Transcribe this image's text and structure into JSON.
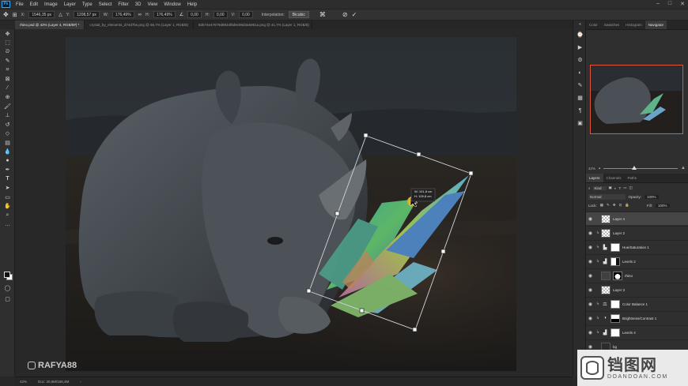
{
  "app": {
    "logo": "Ps"
  },
  "menu": [
    "File",
    "Edit",
    "Image",
    "Layer",
    "Type",
    "Select",
    "Filter",
    "3D",
    "View",
    "Window",
    "Help"
  ],
  "options": {
    "x_label": "X:",
    "x_value": "1546,35 px",
    "y_label": "Y:",
    "y_value": "1208,57 px",
    "w_label": "W:",
    "w_value": "176,49%",
    "h_label": "H:",
    "h_value": "176,49%",
    "angle_value": "0,00",
    "h2_label": "H:",
    "h2_value": "0,00",
    "v_label": "V:",
    "v_value": "0,00",
    "interp_label": "Interpolation:",
    "interp_value": "Bicubic"
  },
  "tabs": [
    {
      "label": "rhino.psd @ 42% (Layer 4, RGB/8#) *",
      "active": true
    },
    {
      "label": "crystal_by_elements_d74d7bs.png @ 66,7% (Layer 1, RGB/8)",
      "active": false
    },
    {
      "label": "8d574e47679d8834f8d9c98d3a5951a.png @ 41,7% (Layer 1, RGB/8)",
      "active": false
    }
  ],
  "transform_readout": {
    "w": "W: 101,8 cm",
    "h": "H: 109,8 cm"
  },
  "status": {
    "zoom": "42%",
    "doc": "Doc: 30,6M/166,4M"
  },
  "watermark": {
    "text": "RAFYA88"
  },
  "panel_tabs_top": [
    "Color",
    "Swatches",
    "Histogram",
    "Navigator"
  ],
  "navigator": {
    "zoom": "42%"
  },
  "layers_tabs": [
    "Layers",
    "Channels",
    "Paths"
  ],
  "layers": {
    "kind_label": "Kind",
    "blend_mode": "Normal",
    "opacity_label": "Opacity:",
    "opacity": "100%",
    "lock_label": "Lock:",
    "fill_label": "Fill:",
    "fill": "100%",
    "items": [
      {
        "name": "Layer 4",
        "selected": true
      },
      {
        "name": "Layer 2",
        "selected": false
      },
      {
        "name": "Hue/Saturation 1",
        "selected": false
      },
      {
        "name": "Levels 2",
        "selected": false
      },
      {
        "name": "rhino",
        "selected": false
      },
      {
        "name": "Layer 3",
        "selected": false
      },
      {
        "name": "Color Balance 1",
        "selected": false
      },
      {
        "name": "Brightness/Contrast 1",
        "selected": false
      },
      {
        "name": "Levels 4",
        "selected": false
      },
      {
        "name": "bg",
        "selected": false
      }
    ]
  },
  "site_watermark": {
    "big": "铛图网",
    "small": "DOANDOAN.COM"
  },
  "colors": {
    "accent": "#31a8ff",
    "navigator_frame": "#e0553a",
    "selected_layer": "#464646"
  }
}
